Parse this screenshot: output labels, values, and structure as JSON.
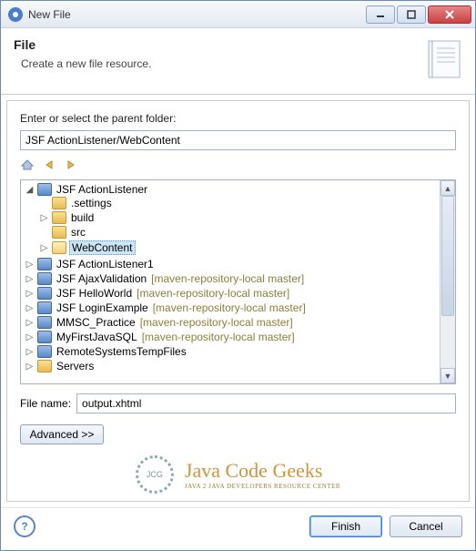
{
  "titlebar": {
    "title": "New File"
  },
  "header": {
    "title": "File",
    "subtitle": "Create a new file resource."
  },
  "folder_label": "Enter or select the parent folder:",
  "path_value": "JSF ActionListener/WebContent",
  "tree": {
    "node0": {
      "label": "JSF ActionListener"
    },
    "node0_0": {
      "label": ".settings"
    },
    "node0_1": {
      "label": "build"
    },
    "node0_2": {
      "label": "src"
    },
    "node0_3": {
      "label": "WebContent"
    },
    "node1": {
      "label": "JSF ActionListener1"
    },
    "node2": {
      "label": "JSF AjaxValidation",
      "decor": "  [maven-repository-local master]"
    },
    "node3": {
      "label": "JSF HelloWorld",
      "decor": "  [maven-repository-local master]"
    },
    "node4": {
      "label": "JSF LoginExample",
      "decor": "  [maven-repository-local master]"
    },
    "node5": {
      "label": "MMSC_Practice",
      "decor": "  [maven-repository-local master]"
    },
    "node6": {
      "label": "MyFirstJavaSQL",
      "decor": "  [maven-repository-local master]"
    },
    "node7": {
      "label": "RemoteSystemsTempFiles"
    },
    "node8": {
      "label": "Servers"
    }
  },
  "filename": {
    "label": "File name:",
    "value": "output.xhtml"
  },
  "advanced_label": "Advanced >>",
  "watermark": {
    "main": "Java Code Geeks",
    "sub": "JAVA 2 JAVA DEVELOPERS RESOURCE CENTER",
    "badge": "JCG"
  },
  "footer": {
    "help": "?",
    "finish": "Finish",
    "cancel": "Cancel"
  }
}
